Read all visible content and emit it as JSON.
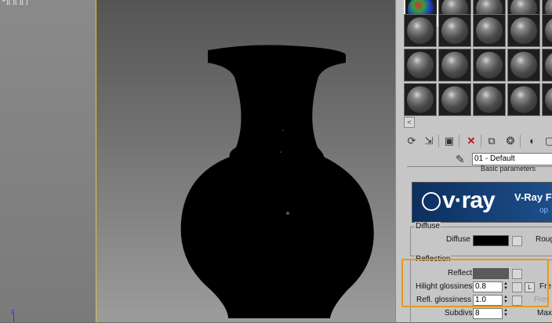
{
  "viewport_left": {
    "corner_label": "+][ ][ ][ ]",
    "axis_label": "z"
  },
  "material_editor": {
    "material_name": "01 - Default",
    "rollout_title": "Basic parameters",
    "banner": {
      "logo": "v·ray",
      "title": "V-Ray F",
      "subtitle": "op"
    },
    "diffuse": {
      "group": "Diffuse",
      "label": "Diffuse",
      "color": "#000000",
      "rough_label": "Roug"
    },
    "reflection": {
      "group": "Reflection",
      "reflect_label": "Reflect",
      "reflect_color": "#5a5a5a",
      "hilight_label": "Hilight glossiness",
      "hilight_value": "0.8",
      "lock_label": "L",
      "fresnel_label": "Fre",
      "refl_label": "Refl. glossiness",
      "refl_value": "1.0",
      "fresnel_ior_label": "Fres",
      "subdivs_label": "Subdivs",
      "subdivs_value": "8",
      "max_label": "Max"
    },
    "nav_arrow": "<"
  },
  "icons": [
    "get-material-icon",
    "put-material-icon",
    "assign-icon",
    "delete-icon",
    "copy-icon",
    "unique-icon",
    "options-icon",
    "eyedropper-icon"
  ],
  "colors": {
    "highlight": "#e39a1c",
    "viewport_border": "#d8c83a"
  }
}
